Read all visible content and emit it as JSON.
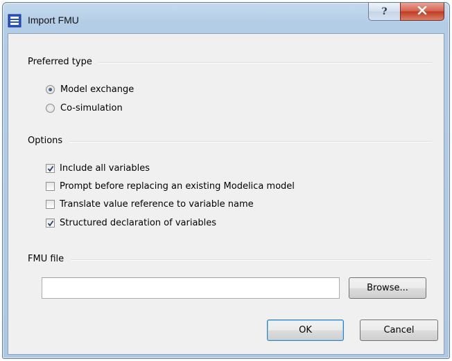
{
  "window": {
    "title": "Import FMU",
    "help_label": "?",
    "app_icon": "fmu-window-icon",
    "close_icon": "close-x-icon"
  },
  "preferred_type": {
    "title": "Preferred type",
    "options": [
      {
        "label": "Model exchange",
        "selected": true
      },
      {
        "label": "Co-simulation",
        "selected": false
      }
    ]
  },
  "options": {
    "title": "Options",
    "items": [
      {
        "label": "Include all variables",
        "checked": true
      },
      {
        "label": "Prompt before replacing an existing Modelica model",
        "checked": false
      },
      {
        "label": "Translate value reference to variable name",
        "checked": false
      },
      {
        "label": "Structured declaration of variables",
        "checked": true
      }
    ]
  },
  "fmu_file": {
    "title": "FMU file",
    "value": "",
    "browse_label": "Browse..."
  },
  "buttons": {
    "ok_label": "OK",
    "cancel_label": "Cancel"
  },
  "colors": {
    "title_bar": "#b3cde6",
    "client_bg": "#f0f0f0",
    "close_button": "#c0391f"
  }
}
